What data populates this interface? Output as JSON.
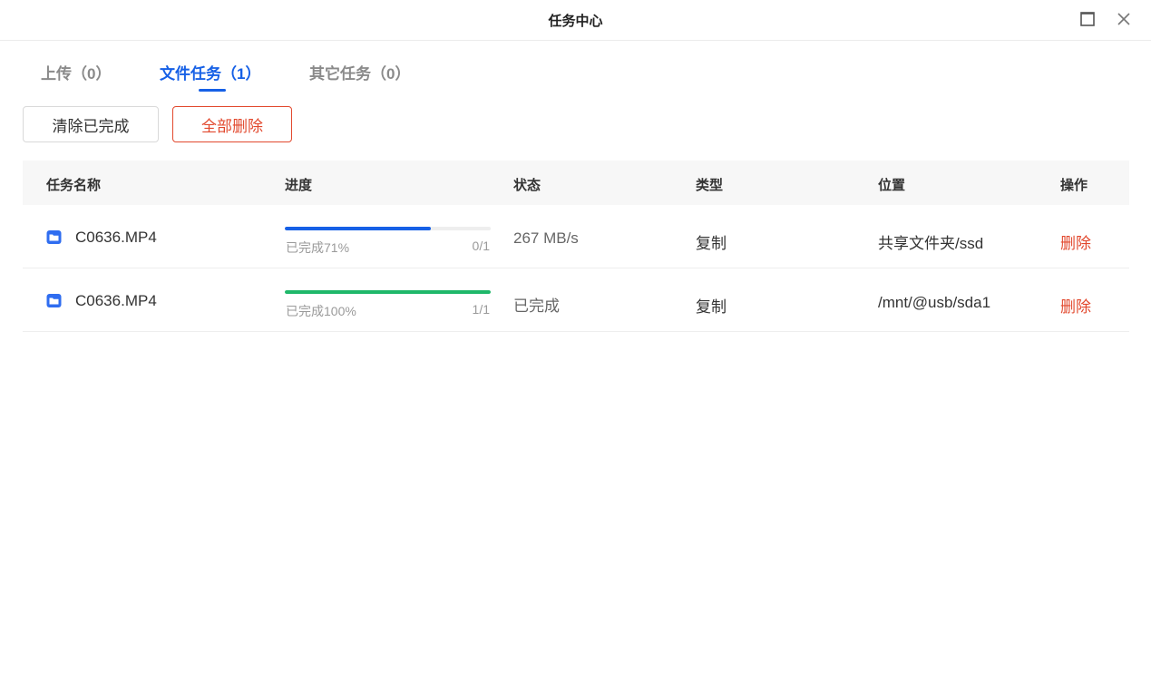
{
  "window": {
    "title": "任务中心"
  },
  "tabs": [
    {
      "label": "上传（0）",
      "active": false
    },
    {
      "label": "文件任务（1）",
      "active": true
    },
    {
      "label": "其它任务（0）",
      "active": false
    }
  ],
  "toolbar": {
    "clear_label": "清除已完成",
    "delete_all_label": "全部删除"
  },
  "table": {
    "headers": {
      "name": "任务名称",
      "progress": "进度",
      "status": "状态",
      "type": "类型",
      "location": "位置",
      "action": "操作"
    },
    "rows": [
      {
        "name": "C0636.MP4",
        "progress_percent": 71,
        "progress_label": "已完成71%",
        "progress_count": "0/1",
        "progress_color": "#1660e6",
        "status": "267 MB/s",
        "type": "复制",
        "location": "共享文件夹/ssd",
        "action": "删除"
      },
      {
        "name": "C0636.MP4",
        "progress_percent": 100,
        "progress_label": "已完成100%",
        "progress_count": "1/1",
        "progress_color": "#1fb86a",
        "status": "已完成",
        "type": "复制",
        "location": "/mnt/@usb/sda1",
        "action": "删除"
      }
    ]
  },
  "colors": {
    "accent": "#1660e6",
    "danger": "#e2482d",
    "success": "#1fb86a"
  },
  "icons": {
    "maximize": "maximize-icon",
    "close": "close-icon",
    "file": "folder-file-icon"
  }
}
